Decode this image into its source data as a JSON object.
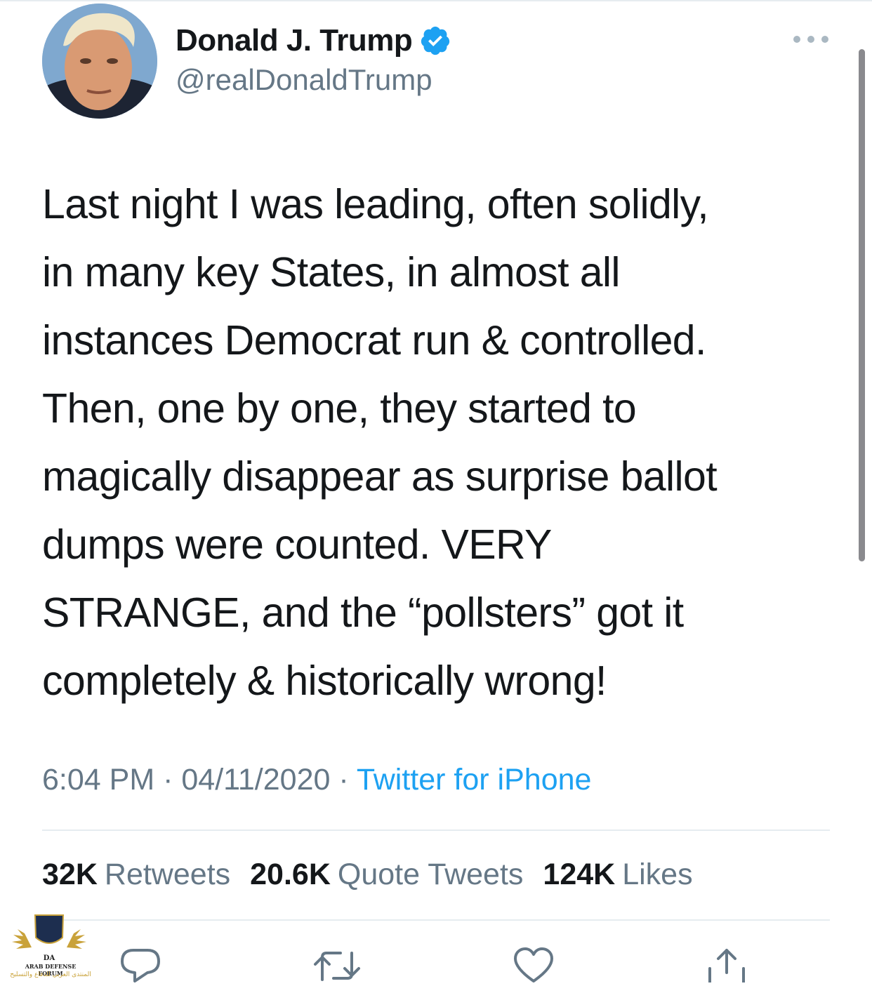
{
  "author": {
    "display_name": "Donald J. Trump",
    "handle": "@realDonaldTrump",
    "verified": true
  },
  "tweet": {
    "text": "Last night I was leading, often solidly,\nin many key States, in almost all\ninstances Democrat run & controlled.\nThen, one by one, they started to\nmagically disappear as surprise ballot\ndumps were counted. VERY\nSTRANGE, and the “pollsters” got it\ncompletely & historically wrong!",
    "time": "6:04 PM",
    "separator": "·",
    "date": "04/11/2020",
    "source": "Twitter for iPhone"
  },
  "stats": {
    "retweets_count": "32K",
    "retweets_label": "Retweets",
    "quotes_count": "20.6K",
    "quotes_label": "Quote Tweets",
    "likes_count": "124K",
    "likes_label": "Likes"
  },
  "actions": {
    "reply_icon": "reply-icon",
    "retweet_icon": "retweet-icon",
    "like_icon": "heart-icon",
    "share_icon": "share-icon"
  },
  "watermark": {
    "monogram": "DA",
    "title": "ARAB DEFENSE FORUM",
    "subtitle": "المنتدى العربي للدفاع والتسليح"
  },
  "colors": {
    "text_primary": "#14171a",
    "text_secondary": "#657786",
    "link": "#1da1f2",
    "verified_badge": "#1da1f2",
    "divider": "#e6ecf0"
  }
}
